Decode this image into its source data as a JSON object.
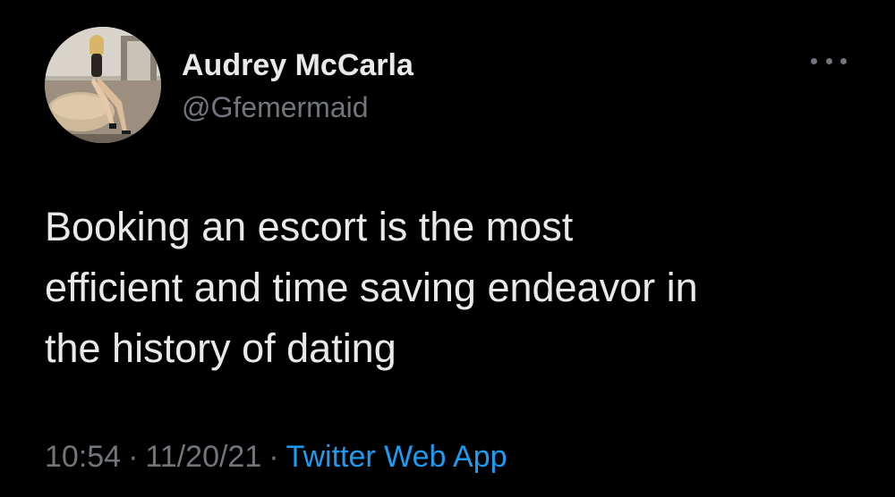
{
  "author": {
    "name": "Audrey McCarla",
    "handle": "@Gfemermaid",
    "avatar_icon": "profile-photo-icon"
  },
  "tweet": {
    "lines": [
      "Booking an escort is the most",
      "efficient and time saving endeavor in",
      "the history of dating"
    ]
  },
  "meta": {
    "time": "10:54",
    "date": "11/20/21",
    "separator": "·",
    "source": "Twitter Web App"
  },
  "colors": {
    "background": "#000000",
    "primary_text": "#e7e9ea",
    "secondary_text": "#71767b",
    "link": "#1d9bf0"
  },
  "more_icon": "more-horizontal-icon"
}
